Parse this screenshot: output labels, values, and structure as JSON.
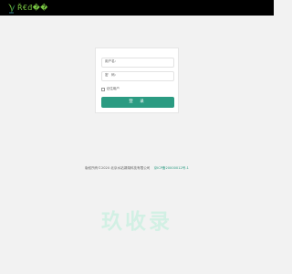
{
  "header": {
    "logo_text": "Ř€đ��"
  },
  "login": {
    "username_label": "用户名：",
    "username_value": "",
    "password_label": "密　码：",
    "password_value": "",
    "remember_label": "记住用户",
    "submit_label": "登 录"
  },
  "footer": {
    "copyright": "版权所有©2020 北京水站湖湖科技有限公司",
    "icp": "京ICP备20000012号-1"
  },
  "watermark": {
    "text": "玖收录"
  },
  "colors": {
    "topbar": "#000000",
    "accent": "#2b9b82",
    "logo": "#7ac943",
    "background": "#f2f2f2",
    "watermark": "#d2f0e4"
  }
}
